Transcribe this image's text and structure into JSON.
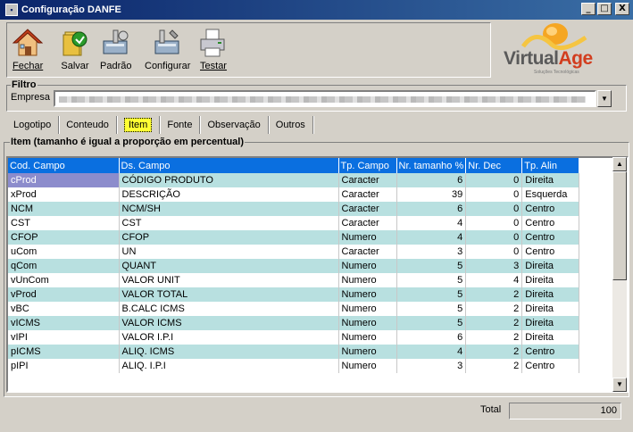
{
  "window": {
    "title": "Configuração DANFE",
    "min_glyph": "_",
    "max_glyph": "□",
    "close_glyph": "X"
  },
  "toolbar": {
    "buttons": [
      {
        "label": "Fechar",
        "icon": "house-icon"
      },
      {
        "label": "Salvar",
        "icon": "save-folder-icon"
      },
      {
        "label": "Padrão",
        "icon": "default-settings-icon"
      },
      {
        "label": "Configurar",
        "icon": "configure-icon"
      },
      {
        "label": "Testar",
        "icon": "printer-icon"
      }
    ]
  },
  "logo": {
    "text_virtual": "Virtual",
    "text_age": "Age",
    "tagline": "Soluções Tecnológicas"
  },
  "filtro": {
    "title": "Filtro",
    "empresa_label": "Empresa"
  },
  "tabs": [
    {
      "label": "Logotipo",
      "active": false
    },
    {
      "label": "Conteudo",
      "active": false
    },
    {
      "label": "Item",
      "active": true
    },
    {
      "label": "Fonte",
      "active": false
    },
    {
      "label": "Observação",
      "active": false
    },
    {
      "label": "Outros",
      "active": false
    }
  ],
  "item_group": {
    "title": "Item (tamanho é igual a proporção em percentual)"
  },
  "grid": {
    "columns": [
      "Cod. Campo",
      "Ds. Campo",
      "Tp. Campo",
      "Nr. tamanho %",
      "Nr. Dec",
      "Tp. Alin"
    ],
    "rows": [
      [
        "cProd",
        "CÓDIGO PRODUTO",
        "Caracter",
        "6",
        "0",
        "Direita"
      ],
      [
        "xProd",
        "DESCRIÇÃO",
        "Caracter",
        "39",
        "0",
        "Esquerda"
      ],
      [
        "NCM",
        "NCM/SH",
        "Caracter",
        "6",
        "0",
        "Centro"
      ],
      [
        "CST",
        "CST",
        "Caracter",
        "4",
        "0",
        "Centro"
      ],
      [
        "CFOP",
        "CFOP",
        "Numero",
        "4",
        "0",
        "Centro"
      ],
      [
        "uCom",
        "UN",
        "Caracter",
        "3",
        "0",
        "Centro"
      ],
      [
        "qCom",
        "QUANT",
        "Numero",
        "5",
        "3",
        "Direita"
      ],
      [
        "vUnCom",
        "VALOR UNIT",
        "Numero",
        "5",
        "4",
        "Direita"
      ],
      [
        "vProd",
        "VALOR TOTAL",
        "Numero",
        "5",
        "2",
        "Direita"
      ],
      [
        "vBC",
        "B.CALC ICMS",
        "Numero",
        "5",
        "2",
        "Direita"
      ],
      [
        "vICMS",
        "VALOR ICMS",
        "Numero",
        "5",
        "2",
        "Direita"
      ],
      [
        "vIPI",
        "VALOR I.P.I",
        "Numero",
        "6",
        "2",
        "Direita"
      ],
      [
        "pICMS",
        "ALIQ. ICMS",
        "Numero",
        "4",
        "2",
        "Centro"
      ],
      [
        "pIPI",
        "ALIQ. I.P.I",
        "Numero",
        "3",
        "2",
        "Centro"
      ]
    ],
    "selected_row": 0
  },
  "scrollbar": {
    "up_glyph": "▲",
    "down_glyph": "▼"
  },
  "footer": {
    "total_label": "Total",
    "total_value": "100"
  },
  "colors": {
    "header_bg": "#0a6fe0",
    "row_alt": "#b8e0e0",
    "selected_cell": "#8c8ccc",
    "active_tab": "#ffff33"
  }
}
